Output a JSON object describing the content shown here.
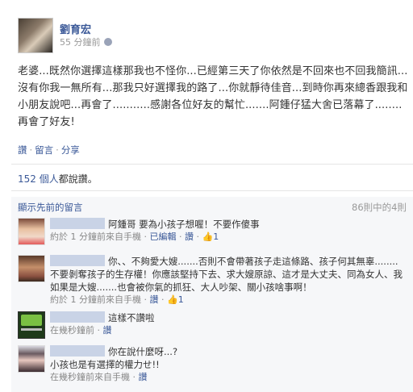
{
  "post": {
    "author": "劉育宏",
    "time": "55 分鐘前",
    "body": "老婆...既然你選擇這樣那我也不怪你...已經第三天了你依然是不回來也不回我簡訊...沒有你我一無所有...那我只好選擇我的路了...你就靜待佳音...到時你再來總香跟我和小朋友說吧...再會了...........感謝各位好友的幫忙.......阿鍾仔猛大舍已落幕了........再會了好友!"
  },
  "actions": {
    "like": "讚",
    "comment": "留言",
    "share": "分享",
    "sep": "·"
  },
  "likes": {
    "count": "152 個人",
    "suffix": "都說讚。"
  },
  "comments_header": {
    "show_previous": "顯示先前的留言",
    "count": "86則中的4則"
  },
  "comments": [
    {
      "text": "阿鍾哥 要為小孩子想喔！不要作傻事",
      "meta_time": "約於 1 分鐘前來自手機",
      "edited": "已編輯",
      "like": "讚",
      "likes": "1"
    },
    {
      "text": "你、、不夠愛大嫂.......否則不會帶著孩子走這條路、孩子何其無辜........不要剝奪孩子的生存權！你應該堅持下去、求大嫂原諒、這才是大丈夫、同為女人、我如果是大嫂.......也會被你氣的抓狂、大人吵架、關小孩啥事啊！",
      "meta_time": "約於 1 分鐘前來自手機",
      "like": "讚",
      "likes": "1"
    },
    {
      "text": "這樣不讚啦",
      "meta_time": "在幾秒鐘前",
      "like": "讚"
    },
    {
      "text": "你在說什麼呀...?",
      "text2": "小孩也是有選擇的權力せ!!",
      "meta_time": "在幾秒鐘前來自手機",
      "like": "讚"
    }
  ],
  "icons": {
    "globe": "globe-icon",
    "thumb": "thumbs-up-icon"
  }
}
